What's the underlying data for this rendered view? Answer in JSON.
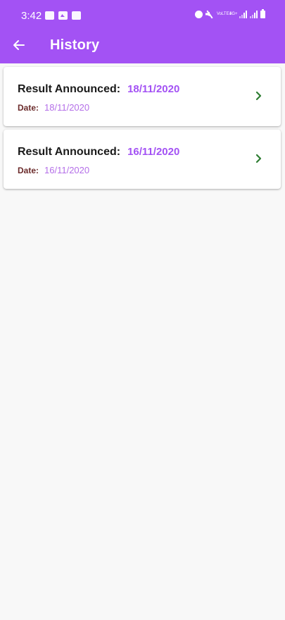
{
  "status_bar": {
    "time": "3:42",
    "left_icons": [
      "message-icon",
      "image-icon",
      "chat-icon"
    ],
    "right_icons": [
      "alarm-icon",
      "mute-icon",
      "volte-icon",
      "4g-icon",
      "signal-icon",
      "signal-icon",
      "battery-icon"
    ],
    "volte_text": "VoLTE1",
    "net_text": "4G+"
  },
  "app_bar": {
    "title": "History",
    "back_icon": "arrow-left-icon",
    "color": "#a352f4"
  },
  "history": {
    "items": [
      {
        "result_label": "Result Announced:",
        "result_date": "18/11/2020",
        "date_label": "Date:",
        "date_value": "18/11/2020"
      },
      {
        "result_label": "Result Announced:",
        "result_date": "16/11/2020",
        "date_label": "Date:",
        "date_value": "16/11/2020"
      }
    ],
    "chevron_icon": "chevron-right-icon",
    "chevron_color": "#2e7d32"
  }
}
